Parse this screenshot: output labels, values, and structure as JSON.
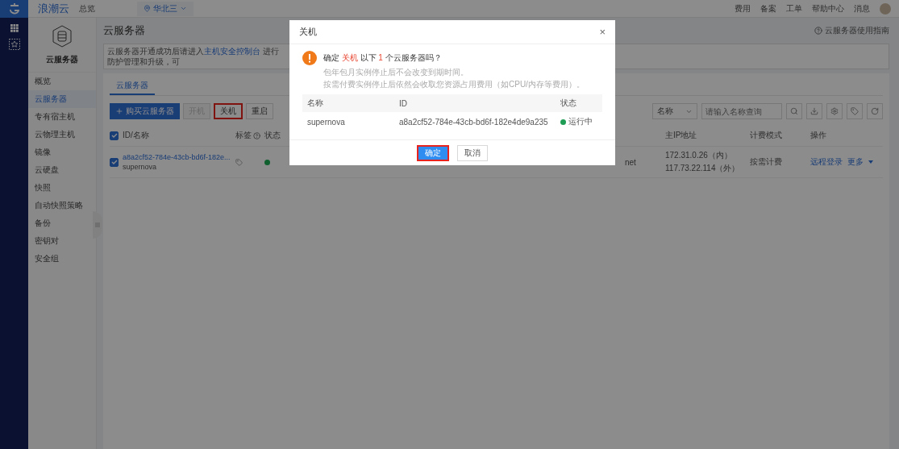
{
  "topbar": {
    "brand": "浪潮云",
    "overview": "总览",
    "region": "华北三",
    "links": [
      "费用",
      "备案",
      "工单",
      "帮助中心",
      "消息"
    ]
  },
  "sidebar": {
    "title": "云服务器",
    "items": [
      {
        "label": "概览",
        "selected": false
      },
      {
        "label": "云服务器",
        "selected": true
      },
      {
        "label": "专有宿主机",
        "selected": false
      },
      {
        "label": "云物理主机",
        "selected": false
      },
      {
        "label": "镜像",
        "selected": false
      },
      {
        "label": "云硬盘",
        "selected": false
      },
      {
        "label": "快照",
        "selected": false
      },
      {
        "label": "自动快照策略",
        "selected": false
      },
      {
        "label": "备份",
        "selected": false
      },
      {
        "label": "密钥对",
        "selected": false
      },
      {
        "label": "安全组",
        "selected": false
      }
    ]
  },
  "main": {
    "title": "云服务器",
    "guide": "云服务器使用指南",
    "notice": {
      "before": "云服务器开通成功后请进入",
      "link": "主机安全控制台",
      "after": " 进行防护管理和升级，可"
    },
    "tabs": [
      {
        "label": "云服务器",
        "selected": true
      }
    ],
    "toolbar": [
      {
        "label": "购买云服务器",
        "kind": "primary",
        "disabled": false,
        "highlighted": false
      },
      {
        "label": "开机",
        "kind": "default",
        "disabled": true,
        "highlighted": false
      },
      {
        "label": "关机",
        "kind": "default",
        "disabled": false,
        "highlighted": true
      },
      {
        "label": "重启",
        "kind": "default",
        "disabled": false,
        "highlighted": false
      }
    ],
    "filter": {
      "field": "名称",
      "placeholder": "请输入名称查询"
    },
    "table": {
      "all_checked": true,
      "columns": [
        "ID/名称",
        "标签",
        "状态",
        "主IP地址",
        "计费模式",
        "操作"
      ],
      "rows": [
        {
          "checked": true,
          "id": "a8a2cf52-784e-43cb-bd6f-182e...",
          "name": "supernova",
          "color": "#10602f",
          "column_5": "net",
          "ip_internal": "172.31.0.26（内）",
          "ip_external": "117.73.22.114（外）",
          "billing": "按需计费",
          "actions": [
            "远程登录",
            "更多"
          ]
        }
      ]
    }
  },
  "modal": {
    "title": "关机",
    "close": "×",
    "question": [
      {
        "text": "确定 ",
        "highlight": false
      },
      {
        "text": "关机",
        "highlight": true
      },
      {
        "text": " 以下 ",
        "highlight": false
      },
      {
        "text": "1",
        "highlight": true
      },
      {
        "text": " 个云服务器吗？",
        "highlight": false
      }
    ],
    "notes": [
      "包年包月实例停止后不会改变到期时间。",
      "按需付费实例停止后依然会收取您资源占用费用（如CPU/内存等费用）。"
    ],
    "columns": [
      "名称",
      "ID",
      "状态"
    ],
    "rows": [
      {
        "name": "supernova",
        "id": "a8a2cf52-784e-43cb-bd6f-182e4de9a235",
        "status": "运行中",
        "color": "#1f9d55"
      }
    ],
    "buttons": [
      {
        "label": "确定",
        "kind": "primary",
        "highlighted": true
      },
      {
        "label": "取消",
        "kind": "default",
        "highlighted": false
      }
    ]
  }
}
